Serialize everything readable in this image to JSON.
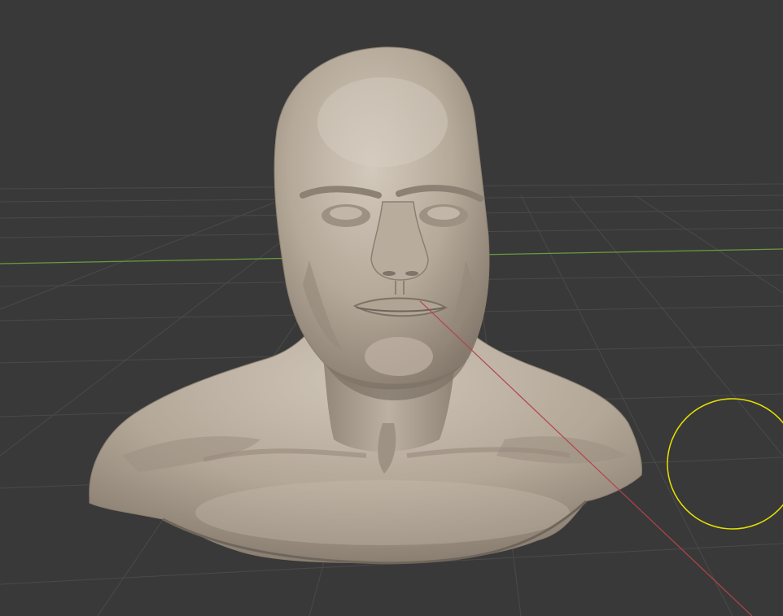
{
  "viewport": {
    "background_color": "#393939",
    "grid_color": "#4a4a4a",
    "x_axis_color": "#b4434e",
    "y_axis_color": "#6c9a3c",
    "sculpt_color": "#b7ab9c",
    "sculpt_shadow_color": "#7e7366",
    "sculpt_highlight_color": "#d6cdc1",
    "brush_cursor_color": "#e6e100"
  },
  "scene": {
    "object": "sculpt-bust",
    "tool": "sculpt-brush-cursor"
  }
}
